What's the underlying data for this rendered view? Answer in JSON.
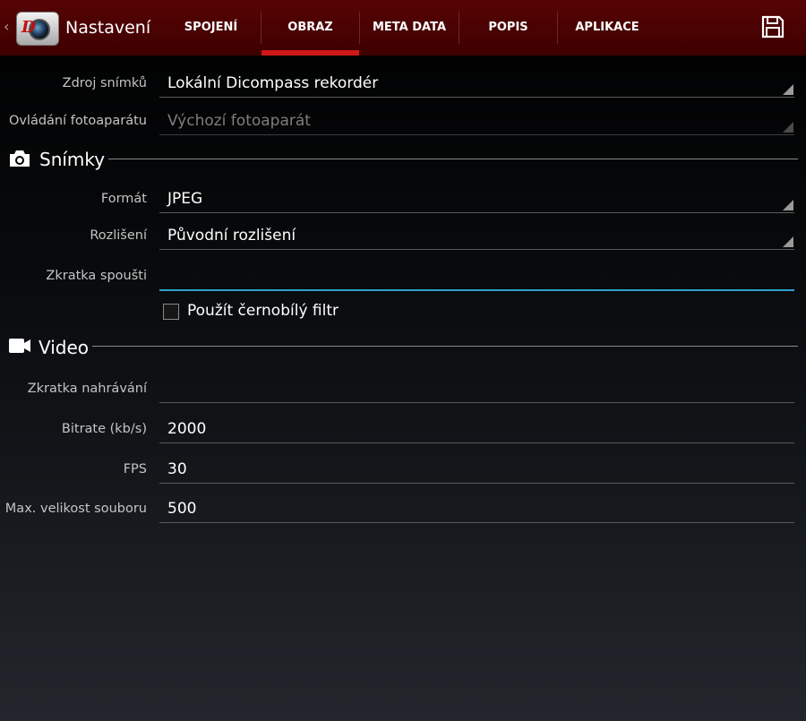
{
  "header": {
    "title": "Nastavení",
    "tabs": [
      {
        "label": "SPOJENÍ",
        "active": false
      },
      {
        "label": "OBRAZ",
        "active": true
      },
      {
        "label": "META DATA",
        "active": false
      },
      {
        "label": "POPIS",
        "active": false
      },
      {
        "label": "APLIKACE",
        "active": false
      }
    ],
    "accent_color": "#d01818",
    "bar_color": "#4a0202"
  },
  "general": {
    "source": {
      "label": "Zdroj snímků",
      "value": "Lokální Dicompass rekordér"
    },
    "camera_control": {
      "label": "Ovládání fotoaparátu",
      "value": "Výchozí fotoaparát"
    }
  },
  "photos": {
    "title": "Snímky",
    "format": {
      "label": "Formát",
      "value": "JPEG"
    },
    "resolution": {
      "label": "Rozlišení",
      "value": "Původní rozlišení"
    },
    "shutter_shortcut": {
      "label": "Zkratka spoušti",
      "value": ""
    },
    "bw_filter": {
      "label": "Použít černobílý filtr",
      "checked": false
    }
  },
  "video": {
    "title": "Video",
    "record_shortcut": {
      "label": "Zkratka nahrávání",
      "value": ""
    },
    "bitrate": {
      "label": "Bitrate (kb/s)",
      "value": "2000"
    },
    "fps": {
      "label": "FPS",
      "value": "30"
    },
    "max_file_size": {
      "label": "Max. velikost souboru",
      "value": "500"
    }
  },
  "icons": [
    "back-chevron-icon",
    "app-logo-icon",
    "save-icon",
    "camera-icon",
    "video-camera-icon"
  ]
}
